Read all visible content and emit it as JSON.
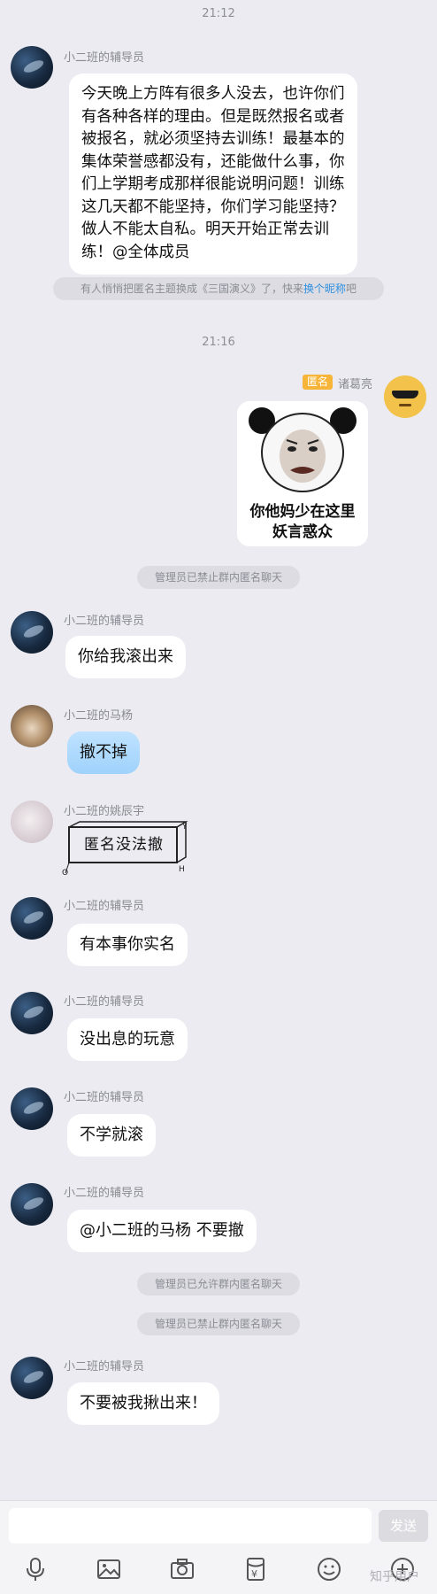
{
  "chat": {
    "time_1": "21:12",
    "time_2": "21:16",
    "messages": {
      "m1_sender": "小二班的辅导员",
      "m1_text": "今天晚上方阵有很多人没去，也许你们有各种各样的理由。但是既然报名或者被报名，就必须坚持去训练！最基本的集体荣誉感都没有，还能做什么事，你们上学期考成那样很能说明问题！训练这几天都不能坚持，你们学习能坚持？做人不能太自私。明天开始正常去训练！@全体成员",
      "notice_theme": "有人悄悄把匿名主题换成《三国演义》了，快来",
      "notice_theme_link": "换个昵称",
      "notice_theme_end": "吧",
      "anon_tag": "匿名",
      "anon_name": "诸葛亮",
      "meme_caption_1": "你他妈少在这里",
      "meme_caption_2": "妖言惑众",
      "notice_ban_1": "管理员已禁止群内匿名聊天",
      "m2_sender": "小二班的辅导员",
      "m2_text": "你给我滚出来",
      "m3_sender": "小二班的马杨",
      "m3_text": "撤不掉",
      "m4_sender": "小二班的姚辰宇",
      "m4_sticker": "匿名没法撤",
      "m5_sender": "小二班的辅导员",
      "m5_text": "有本事你实名",
      "m6_sender": "小二班的辅导员",
      "m6_text": "没出息的玩意",
      "m7_sender": "小二班的辅导员",
      "m7_text": "不学就滚",
      "m8_sender": "小二班的辅导员",
      "m8_text": "@小二班的马杨 不要撤",
      "notice_allow": "管理员已允许群内匿名聊天",
      "notice_ban_2": "管理员已禁止群内匿名聊天",
      "m9_sender": "小二班的辅导员",
      "m9_text": "不要被我揪出来！"
    }
  },
  "input": {
    "send_label": "发送"
  },
  "toolbar": {
    "icons": [
      "microphone-icon",
      "image-icon",
      "camera-icon",
      "red-packet-icon",
      "emoji-icon",
      "more-icon"
    ]
  },
  "watermark": "知乎用户",
  "colors": {
    "background": "#ebebf1",
    "bubble": "#ffffff",
    "bubble_blue": "#aad7fc",
    "link": "#2f8fe0",
    "anon_tag": "#f6b438"
  }
}
